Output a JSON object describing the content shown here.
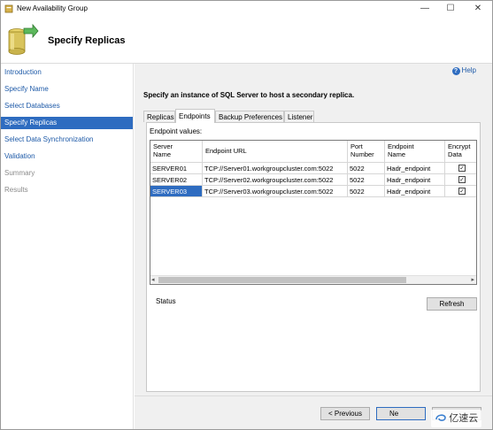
{
  "window": {
    "title": "New Availability Group",
    "minimize": "—",
    "maximize": "☐",
    "close": "✕"
  },
  "header": {
    "title": "Specify Replicas"
  },
  "nav": {
    "items": [
      {
        "label": "Introduction",
        "state": "normal"
      },
      {
        "label": "Specify Name",
        "state": "normal"
      },
      {
        "label": "Select Databases",
        "state": "normal"
      },
      {
        "label": "Specify Replicas",
        "state": "active"
      },
      {
        "label": "Select Data Synchronization",
        "state": "normal"
      },
      {
        "label": "Validation",
        "state": "normal"
      },
      {
        "label": "Summary",
        "state": "disabled"
      },
      {
        "label": "Results",
        "state": "disabled"
      }
    ]
  },
  "main": {
    "help_label": "Help",
    "instruction": "Specify an instance of SQL Server to host a secondary replica.",
    "tabs": [
      {
        "label": "Replicas",
        "active": false
      },
      {
        "label": "Endpoints",
        "active": true
      },
      {
        "label": "Backup Preferences",
        "active": false
      },
      {
        "label": "Listener",
        "active": false
      }
    ],
    "endpoint_values_label": "Endpoint values:",
    "table": {
      "columns": [
        {
          "line1": "Server",
          "line2": "Name"
        },
        {
          "line1": "Endpoint URL",
          "line2": ""
        },
        {
          "line1": "Port",
          "line2": "Number"
        },
        {
          "line1": "Endpoint",
          "line2": "Name"
        },
        {
          "line1": "Encrypt",
          "line2": "Data"
        }
      ],
      "rows": [
        {
          "server": "SERVER01",
          "url": "TCP://Server01.workgroupcluster.com:5022",
          "port": "5022",
          "endpoint": "Hadr_endpoint",
          "encrypt": true,
          "selected": false
        },
        {
          "server": "SERVER02",
          "url": "TCP://Server02.workgroupcluster.com:5022",
          "port": "5022",
          "endpoint": "Hadr_endpoint",
          "encrypt": true,
          "selected": false
        },
        {
          "server": "SERVER03",
          "url": "TCP://Server03.workgroupcluster.com:5022",
          "port": "5022",
          "endpoint": "Hadr_endpoint",
          "encrypt": true,
          "selected": true
        }
      ]
    },
    "status_label": "Status",
    "refresh_label": "Refresh",
    "previous_label": "< Previous",
    "next_label": "Ne",
    "cancel_label": ""
  },
  "watermark": {
    "text": "亿速云"
  },
  "colors": {
    "accent": "#2e6cc0",
    "link": "#1e5aa8"
  }
}
